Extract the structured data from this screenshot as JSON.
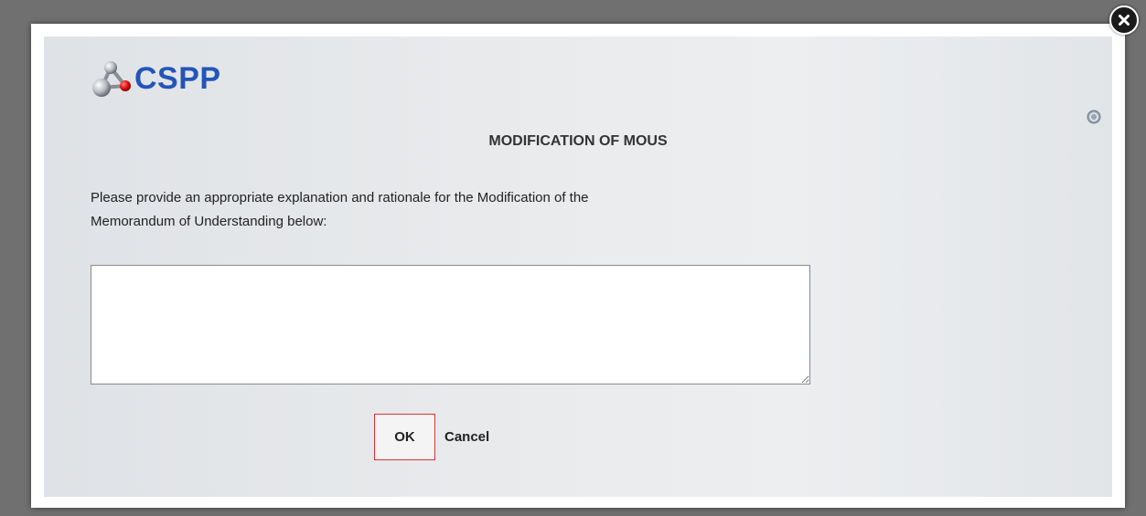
{
  "brand": {
    "logo_text": "CSPP",
    "logo_icon": "molecule-icon",
    "accent_color": "#2355b8"
  },
  "dialog": {
    "title": "MODIFICATION OF MOUS",
    "instructions_line1": "Please provide an appropriate explanation and rationale for the Modification of the",
    "instructions_line2": "Memorandum of Understanding below:",
    "explanation_value": "",
    "ok_label": "OK",
    "cancel_label": "Cancel",
    "close_icon": "close-icon",
    "help_icon": "help-icon"
  }
}
